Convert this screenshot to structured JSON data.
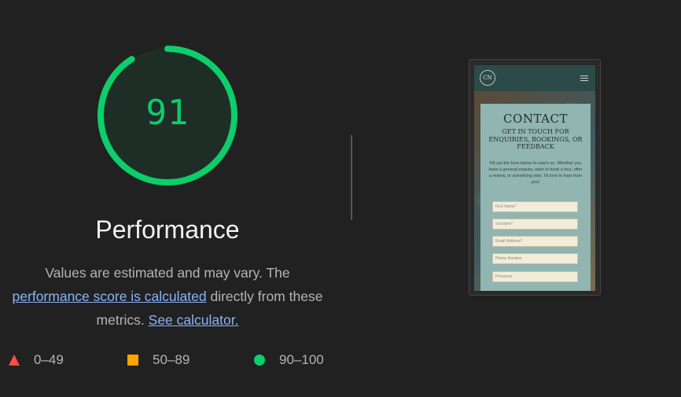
{
  "score": {
    "value": "91",
    "fraction": 0.91,
    "color": "#0cce6b",
    "track_color": "#1e3b2b"
  },
  "category_title": "Performance",
  "description": {
    "line1": "Values are estimated and may vary. The",
    "link1": "performance score is calculated",
    "line2_rest": " directly from these",
    "line3": "metrics. ",
    "link2": "See calculator."
  },
  "legend": [
    {
      "label": "0–49",
      "shape": "triangle",
      "color": "#ff4e42"
    },
    {
      "label": "50–89",
      "shape": "square",
      "color": "#ffa400"
    },
    {
      "label": "90–100",
      "shape": "circle",
      "color": "#0cce6b"
    }
  ],
  "screenshot": {
    "logo_text": "CN",
    "menu_icon": "hamburger-icon",
    "card_title": "CONTACT",
    "card_subtitle": "GET IN TOUCH FOR ENQUIRIES, BOOKINGS, OR FEEDBACK",
    "card_text": "Fill out the form below to reach us. Whether you have a general enquiry, want to book a tour, offer a review, or something else, I'd love to hear from you!",
    "fields": [
      "First Name*",
      "Surname*",
      "Email Address*",
      "Phone Number",
      "Pronouns"
    ]
  }
}
